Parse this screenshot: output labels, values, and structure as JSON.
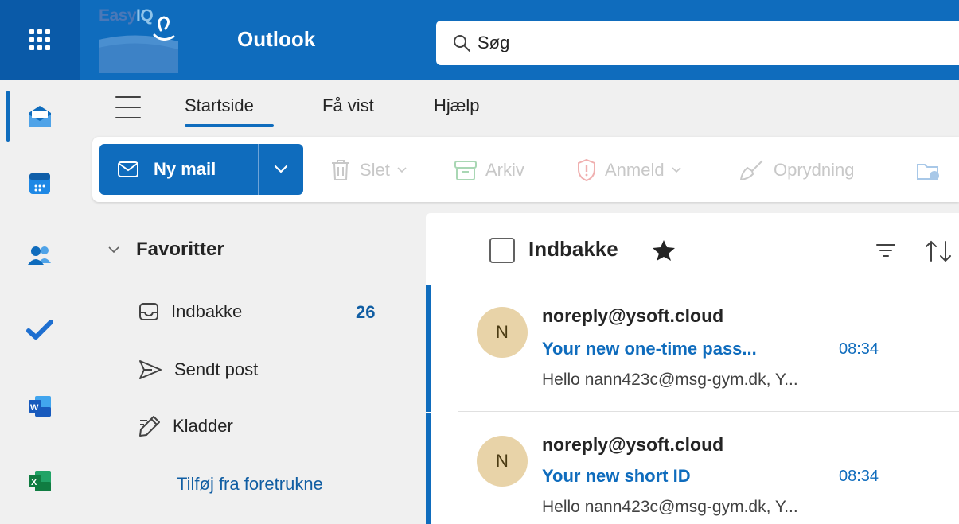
{
  "topbar": {
    "logo_part1": "Easy",
    "logo_part2": "IQ",
    "app_title": "Outlook",
    "search_placeholder": "Søg"
  },
  "ribbon": {
    "tabs": [
      {
        "label": "Startside",
        "active": true
      },
      {
        "label": "Få vist",
        "active": false
      },
      {
        "label": "Hjælp",
        "active": false
      }
    ],
    "new_mail_label": "Ny mail",
    "tools": [
      {
        "label": "Slet",
        "icon": "trash-icon"
      },
      {
        "label": "Arkiv",
        "icon": "archive-icon"
      },
      {
        "label": "Anmeld",
        "icon": "report-shield-icon"
      },
      {
        "label": "Oprydning",
        "icon": "sweep-broom-icon"
      }
    ]
  },
  "folders": {
    "favorites_label": "Favoritter",
    "items": [
      {
        "label": "Indbakke",
        "icon": "inbox-icon",
        "count": "26"
      },
      {
        "label": "Sendt post",
        "icon": "send-icon"
      },
      {
        "label": "Kladder",
        "icon": "drafts-pencil-icon"
      }
    ],
    "add_favorite_label": "Tilføj fra foretrukne"
  },
  "message_list": {
    "title": "Indbakke",
    "messages": [
      {
        "avatar_initial": "N",
        "sender": "noreply@ysoft.cloud",
        "subject": "Your new one-time pass...",
        "time": "08:34",
        "preview": "Hello nann423c@msg-gym.dk, Y..."
      },
      {
        "avatar_initial": "N",
        "sender": "noreply@ysoft.cloud",
        "subject": "Your new short ID",
        "time": "08:34",
        "preview": "Hello nann423c@msg-gym.dk, Y..."
      }
    ]
  },
  "colors": {
    "brand": "#0f6cbd",
    "avatar_bg": "#e8d3a8",
    "disabled_text": "#c8c8c8"
  }
}
